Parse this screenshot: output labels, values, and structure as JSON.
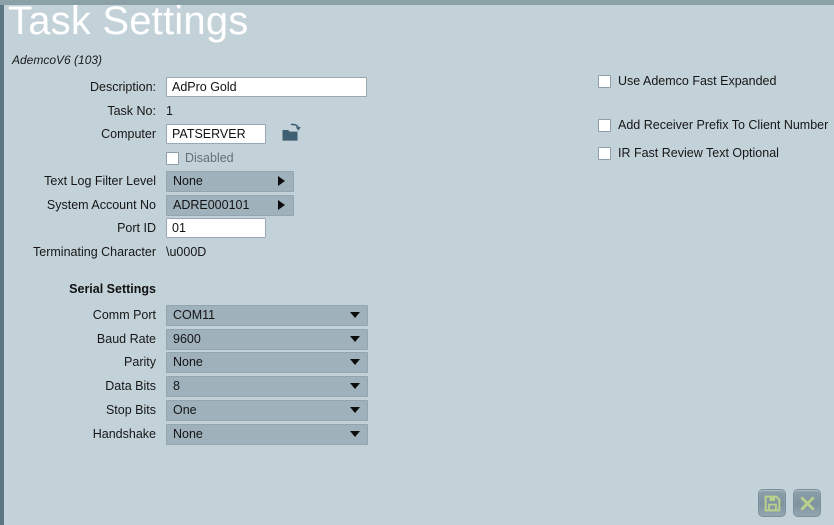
{
  "window": {
    "title": "Task Settings",
    "subtitle": "AdemcoV6 (103)"
  },
  "form": {
    "description": {
      "label": "Description:",
      "value": "AdPro Gold",
      "placeholder": ""
    },
    "task_no": {
      "label": "Task No:",
      "value": "1"
    },
    "computer": {
      "label": "Computer",
      "value": "PATSERVER",
      "placeholder": "",
      "browse_icon": "folder-browse-icon"
    },
    "disabled": {
      "label": "Disabled",
      "checked": false
    },
    "text_log_filter_level": {
      "label": "Text Log Filter Level",
      "value": "None"
    },
    "system_account_no": {
      "label": "System Account No",
      "value": "ADRE000101"
    },
    "port_id": {
      "label": "Port ID",
      "value": "01",
      "placeholder": ""
    },
    "terminating_character": {
      "label": "Terminating Character",
      "value": "\\u000D"
    }
  },
  "serial_settings": {
    "heading": "Serial Settings",
    "fields": [
      {
        "label": "Comm Port",
        "value": "COM11"
      },
      {
        "label": "Baud Rate",
        "value": "9600"
      },
      {
        "label": "Parity",
        "value": "None"
      },
      {
        "label": "Data Bits",
        "value": "8"
      },
      {
        "label": "Stop Bits",
        "value": "One"
      },
      {
        "label": "Handshake",
        "value": "None"
      }
    ]
  },
  "options": [
    {
      "label": "Use Ademco Fast Expanded",
      "checked": false
    },
    {
      "label": "Add Receiver Prefix To Client Number",
      "checked": false
    },
    {
      "label": "IR Fast Review Text Optional",
      "checked": false
    }
  ],
  "footer": {
    "save_label": "save-button",
    "cancel_label": "cancel-button"
  },
  "colors": {
    "background": "#c3d2d9",
    "field_gray": "#9fb1bb",
    "title_text": "#ffffff",
    "icon_green": "#b9d18c",
    "accent_dark": "#5d7683"
  }
}
